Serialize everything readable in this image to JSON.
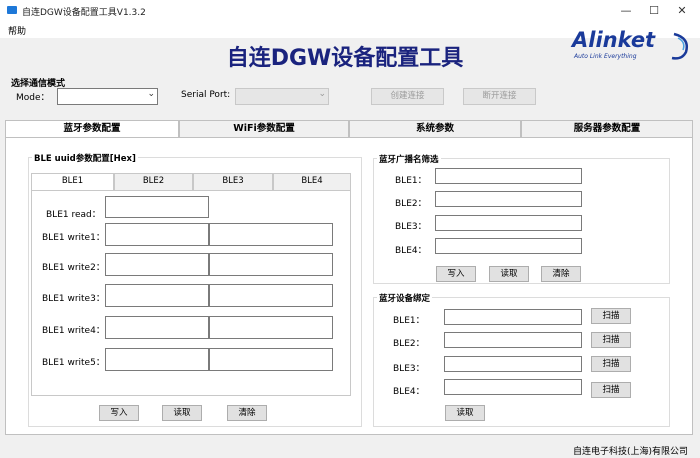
{
  "window": {
    "title": "自连DGW设备配置工具V1.3.2",
    "minimize_glyph": "—",
    "maximize_glyph": "☐",
    "close_glyph": "✕"
  },
  "menu": {
    "help": "帮助"
  },
  "header": {
    "title": "自连DGW设备配置工具",
    "logo_text": "Alinket",
    "logo_tagline": "Auto Link Everything"
  },
  "comm": {
    "section_label": "选择通信模式",
    "mode_label": "Mode：",
    "mode_value": "",
    "serial_label": "Serial Port:",
    "serial_value": "",
    "connect_label": "创建连接",
    "disconnect_label": "断开连接"
  },
  "tabs": [
    "蓝牙参数配置",
    "WiFi参数配置",
    "系统参数",
    "服务器参数配置"
  ],
  "ble_uuid": {
    "group_label": "BLE uuid参数配置[Hex]",
    "tabs": [
      "BLE1",
      "BLE2",
      "BLE3",
      "BLE4"
    ],
    "read_label": "BLE1 read：",
    "write_labels": [
      "BLE1 write1：",
      "BLE1 write2：",
      "BLE1 write3：",
      "BLE1 write4：",
      "BLE1 write5："
    ],
    "write_btn": "写入",
    "read_btn": "读取",
    "clear_btn": "清除"
  },
  "ble_filter": {
    "group_label": "蓝牙广播名筛选",
    "labels": [
      "BLE1：",
      "BLE2：",
      "BLE3：",
      "BLE4："
    ],
    "write_btn": "写入",
    "read_btn": "读取",
    "clear_btn": "清除"
  },
  "ble_bind": {
    "group_label": "蓝牙设备绑定",
    "labels": [
      "BLE1：",
      "BLE2：",
      "BLE3：",
      "BLE4："
    ],
    "scan_btn": "扫描",
    "read_btn": "读取"
  },
  "status": {
    "company": "自连电子科技(上海)有限公司"
  },
  "colors": {
    "title": "#1a237e",
    "logo": "#1a3a9a",
    "icon": "#1e78d8"
  }
}
